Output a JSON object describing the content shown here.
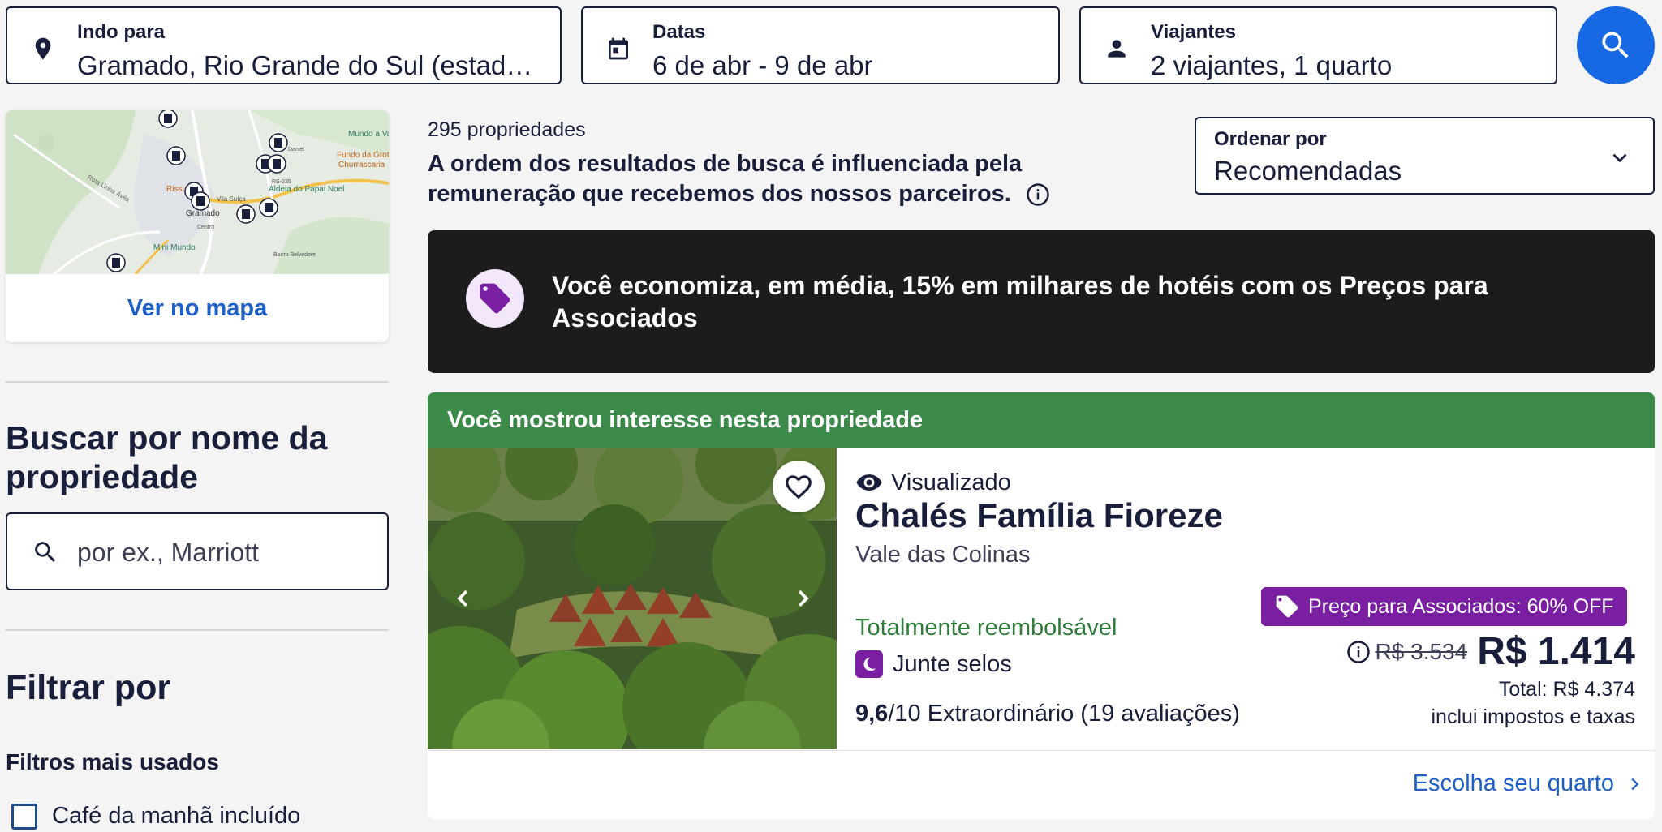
{
  "search": {
    "destination": {
      "label": "Indo para",
      "value": "Gramado, Rio Grande do Sul (estado), Brasil"
    },
    "dates": {
      "label": "Datas",
      "value": "6 de abr - 9 de abr"
    },
    "travelers": {
      "label": "Viajantes",
      "value": "2 viajantes, 1 quarto"
    }
  },
  "map": {
    "link_label": "Ver no mapa",
    "place_labels": [
      "Gramado",
      "Mundo a Vapor",
      "Fundo da Grota",
      "Churrascaria",
      "Rissul",
      "Vila Suíça",
      "Centro",
      "Mini Mundo",
      "Bairro Belvedere",
      "Aldeia do Papai Noel",
      "Rota Linha Ávila",
      "RS-235",
      "Daniel"
    ]
  },
  "sidebar": {
    "name_search_heading": "Buscar por nome da propriedade",
    "name_search_placeholder": "por ex., Marriott",
    "filter_heading": "Filtrar por",
    "popular_filters_heading": "Filtros mais usados",
    "filters": [
      {
        "label": "Café da manhã incluído",
        "checked": false
      }
    ]
  },
  "results": {
    "count": "295 propriedades",
    "disclaimer": "A ordem dos resultados de busca é influenciada pela remuneração que recebemos dos nossos parceiros.",
    "sort": {
      "label": "Ordenar por",
      "value": "Recomendadas"
    }
  },
  "promo": {
    "text": "Você economiza, em média, 15% em milhares de hotéis com os Preços para Associados"
  },
  "property": {
    "banner": "Você mostrou interesse nesta propriedade",
    "viewed": "Visualizado",
    "name": "Chalés Família Fioreze",
    "location": "Vale das Colinas",
    "refundable": "Totalmente reembolsável",
    "stamps": "Junte selos",
    "rating_score": "9,6",
    "rating_text": "/10 Extraordinário (19 avaliações)",
    "member_badge": "Preço para Associados: 60% OFF",
    "old_price": "R$ 3.534",
    "price": "R$ 1.414",
    "total": "Total: R$ 4.374",
    "taxes": "inclui impostos e taxas",
    "cta": "Escolha seu quarto"
  },
  "colors": {
    "primary": "#1668e3",
    "link": "#1f60c6",
    "member_purple": "#7b1fa2",
    "interest_green": "#3c8a4a",
    "promo_dark": "#1c1c1c"
  },
  "icons": [
    "location-pin-icon",
    "calendar-icon",
    "person-icon",
    "search-icon",
    "hotel-marker-icon",
    "info-icon",
    "chevron-down-icon",
    "price-tag-icon",
    "heart-icon",
    "chevron-left-icon",
    "chevron-right-icon",
    "eye-icon",
    "moon-icon"
  ]
}
